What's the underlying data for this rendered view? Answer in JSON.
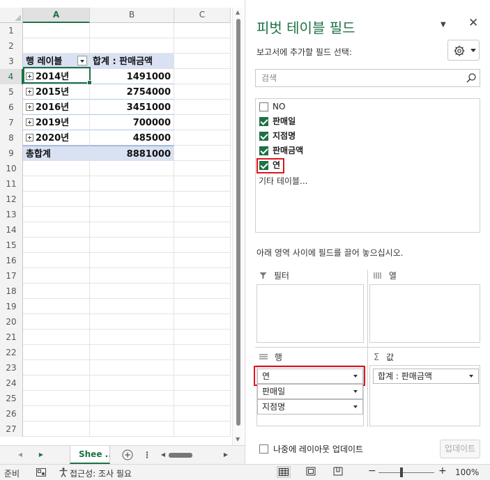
{
  "sheet": {
    "columns": [
      "A",
      "B",
      "C"
    ],
    "row_numbers": [
      "1",
      "2",
      "3",
      "4",
      "5",
      "6",
      "7",
      "8",
      "9",
      "10",
      "11",
      "12",
      "13",
      "14",
      "15",
      "16",
      "17",
      "18",
      "19",
      "20",
      "21",
      "22",
      "23",
      "24",
      "25",
      "26",
      "27"
    ],
    "pivot": {
      "row_label_header": "행 레이블",
      "value_header": "합계 : 판매금액",
      "rows": [
        {
          "label": "2014년",
          "value": "1491000"
        },
        {
          "label": "2015년",
          "value": "2754000"
        },
        {
          "label": "2016년",
          "value": "3451000"
        },
        {
          "label": "2019년",
          "value": "700000"
        },
        {
          "label": "2020년",
          "value": "485000"
        }
      ],
      "total_label": "총합계",
      "total_value": "8881000"
    },
    "tab_label": "Shee",
    "tab_more": "..."
  },
  "pivot_panel": {
    "title": "피벗 테이블 필드",
    "choose_fields_label": "보고서에 추가할 필드 선택:",
    "search_placeholder": "검색",
    "fields": [
      {
        "label": "NO",
        "checked": false
      },
      {
        "label": "판매일",
        "checked": true
      },
      {
        "label": "지점명",
        "checked": true
      },
      {
        "label": "판매금액",
        "checked": true
      },
      {
        "label": "연",
        "checked": true
      }
    ],
    "more_tables": "기타 테이블...",
    "instruction": "아래 영역 사이에 필드를 끌어 놓으십시오.",
    "areas": {
      "filter": {
        "label": "필터",
        "items": []
      },
      "columns": {
        "label": "열",
        "items": []
      },
      "rows": {
        "label": "행",
        "items": [
          "연",
          "판매일",
          "지점명"
        ]
      },
      "values": {
        "label": "값",
        "items": [
          "합계 : 판매금액"
        ]
      }
    },
    "defer_label": "나중에 레이아웃 업데이트",
    "update_button": "업데이트"
  },
  "status_bar": {
    "ready": "준비",
    "accessibility": "접근성: 조사 필요",
    "zoom": "100%"
  },
  "colors": {
    "accent": "#1e7145",
    "highlight": "#e0141e",
    "pivot_header": "#d9e1f2"
  }
}
